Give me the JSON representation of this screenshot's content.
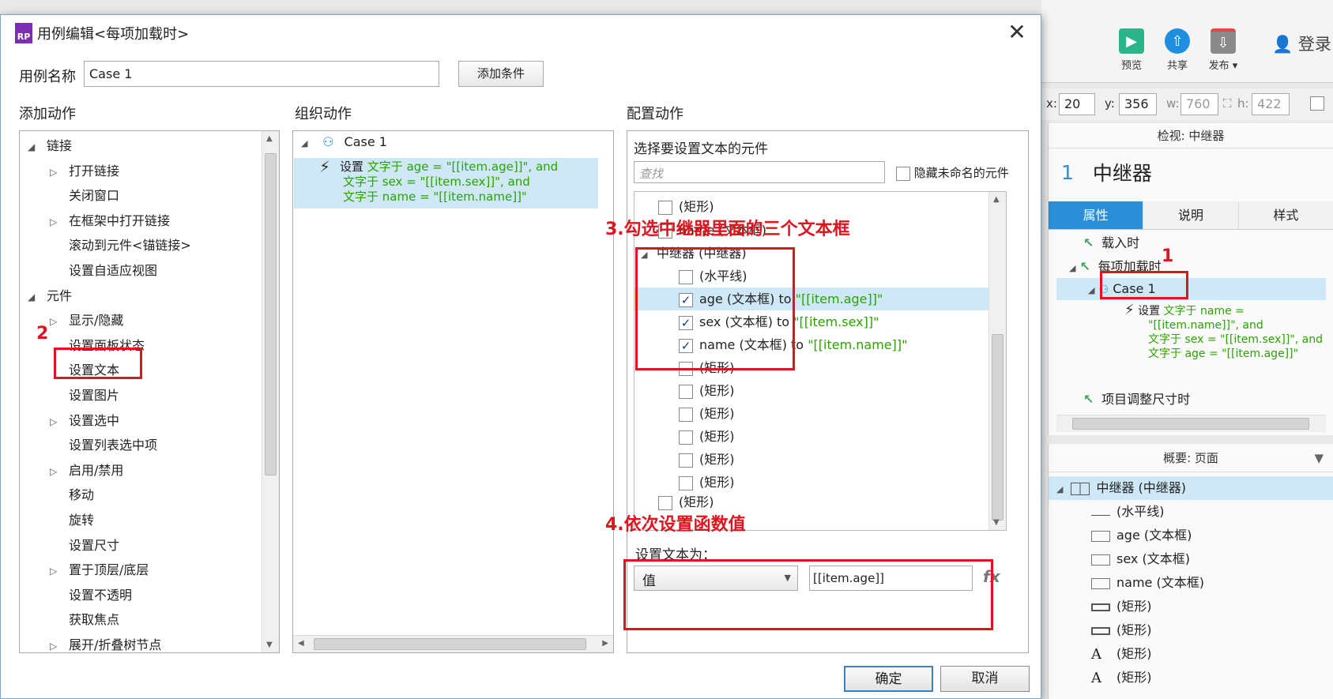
{
  "dialog": {
    "title": "用例编辑<每项加载时>",
    "logo": "RP",
    "case_name_label": "用例名称",
    "case_name_value": "Case 1",
    "add_condition": "添加条件",
    "sections": {
      "add": "添加动作",
      "organize": "组织动作",
      "configure": "配置动作"
    },
    "ok": "确定",
    "cancel": "取消"
  },
  "add_actions": [
    {
      "label": "链接",
      "level": 0,
      "tri": "◢"
    },
    {
      "label": "打开链接",
      "level": 1,
      "tri": "▷"
    },
    {
      "label": "关闭窗口",
      "level": 1,
      "tri": ""
    },
    {
      "label": "在框架中打开链接",
      "level": 1,
      "tri": "▷"
    },
    {
      "label": "滚动到元件<锚链接>",
      "level": 1,
      "tri": ""
    },
    {
      "label": "设置自适应视图",
      "level": 1,
      "tri": ""
    },
    {
      "label": "元件",
      "level": 0,
      "tri": "◢"
    },
    {
      "label": "显示/隐藏",
      "level": 1,
      "tri": "▷"
    },
    {
      "label": "设置面板状态",
      "level": 1,
      "tri": ""
    },
    {
      "label": "设置文本",
      "level": 1,
      "tri": ""
    },
    {
      "label": "设置图片",
      "level": 1,
      "tri": ""
    },
    {
      "label": "设置选中",
      "level": 1,
      "tri": "▷"
    },
    {
      "label": "设置列表选中项",
      "level": 1,
      "tri": ""
    },
    {
      "label": "启用/禁用",
      "level": 1,
      "tri": "▷"
    },
    {
      "label": "移动",
      "level": 1,
      "tri": ""
    },
    {
      "label": "旋转",
      "level": 1,
      "tri": ""
    },
    {
      "label": "设置尺寸",
      "level": 1,
      "tri": ""
    },
    {
      "label": "置于顶层/底层",
      "level": 1,
      "tri": "▷"
    },
    {
      "label": "设置不透明",
      "level": 1,
      "tri": ""
    },
    {
      "label": "获取焦点",
      "level": 1,
      "tri": ""
    },
    {
      "label": "展开/折叠树节点",
      "level": 1,
      "tri": "▷"
    }
  ],
  "organize": {
    "case": "Case 1",
    "action_prefix": "设置",
    "action_lines": [
      "文字于 age = \"[[item.age]]\", and",
      "文字于 sex = \"[[item.sex]]\", and",
      "文字于 name = \"[[item.name]]\""
    ]
  },
  "configure": {
    "subtitle": "选择要设置文本的元件",
    "search_placeholder": "查找",
    "hide_unnamed": "隐藏未命名的元件",
    "rows": [
      {
        "label": "(矩形)",
        "checked": false,
        "indent": 1,
        "tail": ""
      },
      {
        "label": "name (文本框)",
        "checked": false,
        "indent": 1,
        "tail": ""
      },
      {
        "label": "中继器 (中继器)",
        "checked": null,
        "indent": 0,
        "tail": ""
      },
      {
        "label": "(水平线)",
        "checked": false,
        "indent": 2,
        "tail": ""
      },
      {
        "label": "age (文本框) to ",
        "checked": true,
        "indent": 2,
        "tail": "\"[[item.age]]\""
      },
      {
        "label": "sex (文本框) to ",
        "checked": true,
        "indent": 2,
        "tail": "\"[[item.sex]]\""
      },
      {
        "label": "name (文本框) to ",
        "checked": true,
        "indent": 2,
        "tail": "\"[[item.name]]\""
      },
      {
        "label": "(矩形)",
        "checked": false,
        "indent": 2,
        "tail": ""
      },
      {
        "label": "(矩形)",
        "checked": false,
        "indent": 2,
        "tail": ""
      },
      {
        "label": "(矩形)",
        "checked": false,
        "indent": 2,
        "tail": ""
      },
      {
        "label": "(矩形)",
        "checked": false,
        "indent": 2,
        "tail": ""
      },
      {
        "label": "(矩形)",
        "checked": false,
        "indent": 2,
        "tail": ""
      },
      {
        "label": "(矩形)",
        "checked": false,
        "indent": 2,
        "tail": ""
      },
      {
        "label": "(矩形)",
        "checked": false,
        "indent": 1,
        "tail": ""
      }
    ],
    "set_text_label": "设置文本为：",
    "set_text_type": "值",
    "set_text_value": "[[item.age]]",
    "fx": "fx"
  },
  "annotations": {
    "n1": "1",
    "n2": "2",
    "n3": "3.勾选中继器里面的三个文本框",
    "n4": "4.依次设置函数值"
  },
  "toolbar": {
    "preview": "预览",
    "share": "共享",
    "publish": "发布 ▾",
    "login": "登录"
  },
  "coords": {
    "x_label": "x:",
    "x": "20",
    "y_label": "y:",
    "y": "356",
    "w_label": "w:",
    "w": "760",
    "h_label": "h:",
    "h": "422"
  },
  "inspector": {
    "header": "检视: 中继器",
    "index": "1",
    "name": "中继器",
    "tabs": [
      "属性",
      "说明",
      "样式"
    ],
    "events": [
      "载入时",
      "每项加载时",
      "项目调整尺寸时"
    ],
    "case": "Case 1",
    "action_prefix": "设置",
    "action_lines": [
      "文字于 name =",
      "\"[[item.name]]\", and",
      "文字于 sex = \"[[item.sex]]\", and",
      "文字于 age = \"[[item.age]]\""
    ]
  },
  "outline": {
    "header": "概要: 页面",
    "items": [
      {
        "label": "中继器 (中继器)",
        "icon": "repeater-icon"
      },
      {
        "label": "(水平线)",
        "icon": "line-icon"
      },
      {
        "label": "age (文本框)",
        "icon": "textbox-icon"
      },
      {
        "label": "sex (文本框)",
        "icon": "textbox-icon"
      },
      {
        "label": "name (文本框)",
        "icon": "textbox-icon"
      },
      {
        "label": "(矩形)",
        "icon": "rect-icon"
      },
      {
        "label": "(矩形)",
        "icon": "rect-icon"
      },
      {
        "label": "(矩形)",
        "icon": "text-a-icon"
      },
      {
        "label": "(矩形)",
        "icon": "text-a-icon"
      }
    ]
  },
  "colors": {
    "accent": "#2a8fd6",
    "selection": "#cfe8f7",
    "annotation": "#e0141e",
    "action_text": "#2aa300"
  }
}
